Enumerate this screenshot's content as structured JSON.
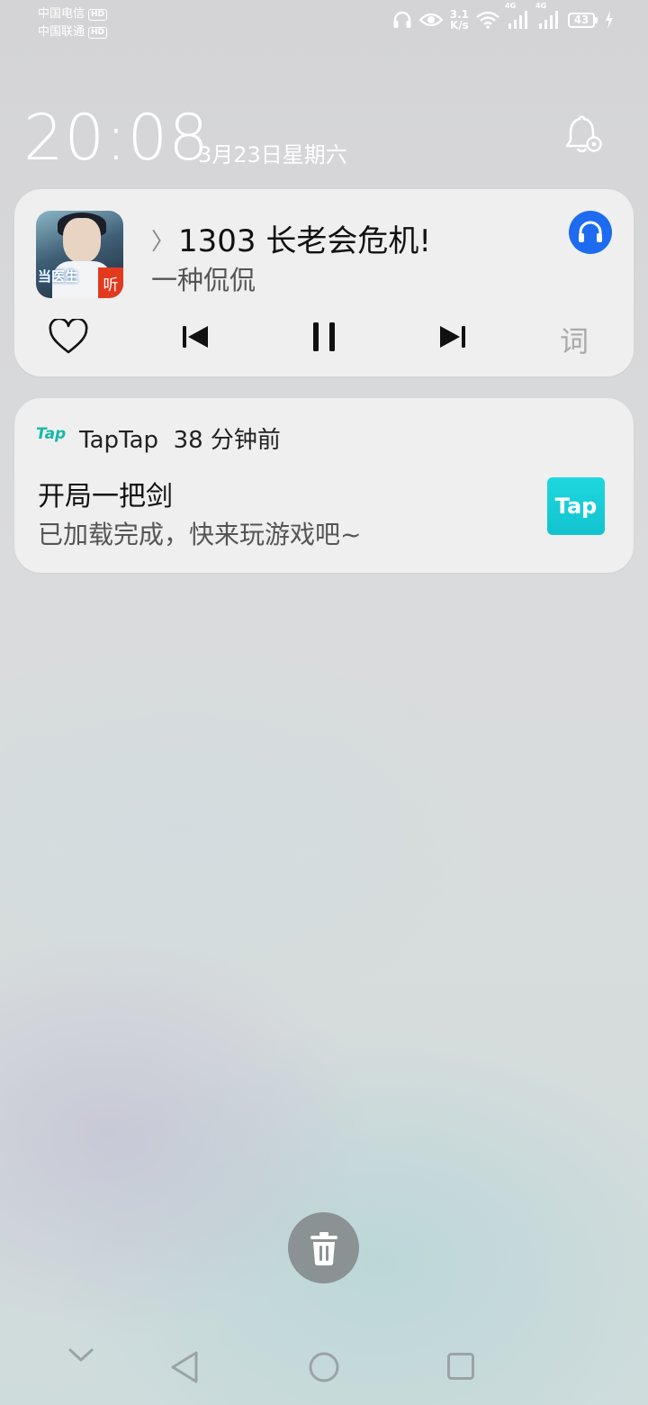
{
  "status_bar": {
    "carrier1": "中国电信",
    "carrier2": "中国联通",
    "hd_badge": "HD",
    "net_speed_value": "3.1",
    "net_speed_unit": "K/s",
    "network1": "4G",
    "network2": "4G",
    "battery": "43"
  },
  "lockscreen": {
    "time": "20:08",
    "date": "3月23日星期六"
  },
  "music": {
    "album_label": "听",
    "album_text": "当医生",
    "chevron": "〉",
    "title": "1303 长老会危机!",
    "artist": "一种侃侃",
    "lyric_button": "词"
  },
  "notification": {
    "app_icon_text": "Tap",
    "app_name": "TapTap",
    "time": "38 分钟前",
    "title": "开局一把剑",
    "body": "已加载完成，快来玩游戏吧~",
    "logo_text": "Tap"
  },
  "colors": {
    "headphone_badge": "#1e6bf0",
    "tap_teal": "#14b9a8",
    "tap_logo": "#12c3cf",
    "clear_button": "#8a9294"
  },
  "icons": [
    "headphones-icon",
    "eye-icon",
    "wifi-icon",
    "signal-icon",
    "battery-icon",
    "charging-icon",
    "bell-settings-icon",
    "heart-icon",
    "previous-icon",
    "pause-icon",
    "next-icon",
    "trash-icon",
    "nav-down-icon",
    "nav-back-icon",
    "nav-home-icon",
    "nav-recents-icon"
  ]
}
